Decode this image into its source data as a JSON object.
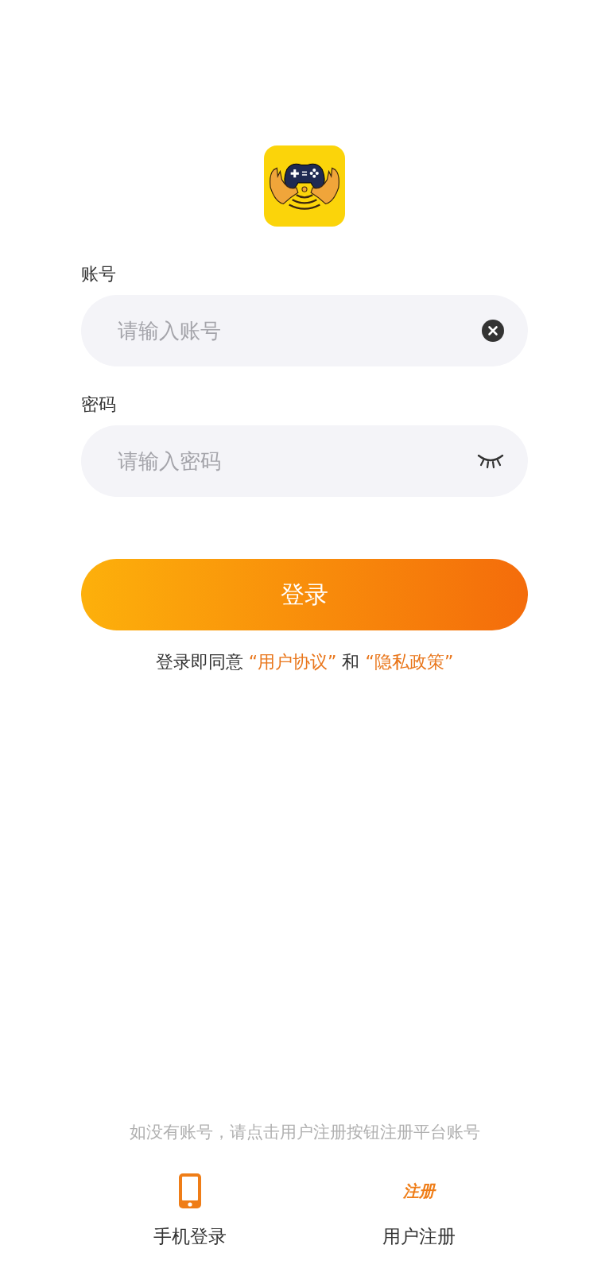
{
  "fields": [
    {
      "kind": "clear",
      "label": "账号",
      "placeholder": "请输入账号"
    },
    {
      "kind": "password",
      "label": "密码",
      "placeholder": "请输入密码"
    }
  ],
  "login_button": "登录",
  "agreement": [
    {
      "kind": "text",
      "text": "登录即同意 "
    },
    {
      "kind": "link",
      "text": "“用户协议”"
    },
    {
      "kind": "text",
      "text": " 和 "
    },
    {
      "kind": "link",
      "text": "“隐私政策”"
    }
  ],
  "hint": "如没有账号，请点击用户注册按钮注册平台账号",
  "options": [
    {
      "kind": "phone",
      "label": "手机登录"
    },
    {
      "kind": "badge",
      "badge": "注册",
      "label": "用户注册"
    }
  ]
}
